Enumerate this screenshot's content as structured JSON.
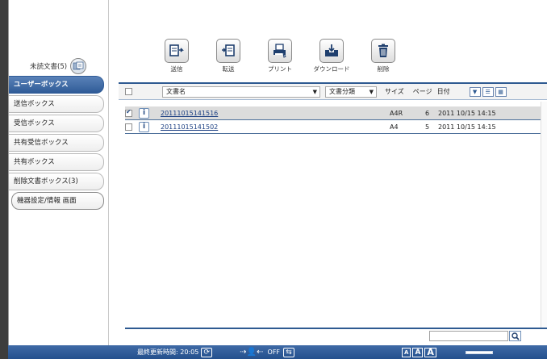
{
  "sidebar": {
    "unread_label": "未読文書(5)",
    "items": [
      {
        "label": "ユーザーボックス",
        "active": true
      },
      {
        "label": "送信ボックス"
      },
      {
        "label": "受信ボックス"
      },
      {
        "label": "共有受信ボックス"
      },
      {
        "label": "共有ボックス"
      },
      {
        "label": "削除文書ボックス(3)"
      }
    ],
    "settings_label": "機器設定/情報 画面"
  },
  "toolbar": {
    "send": "送信",
    "transfer": "転送",
    "print": "プリント",
    "download": "ダウンロード",
    "delete": "削除"
  },
  "table": {
    "col_docname": "文書名",
    "col_category": "文書分類",
    "col_size": "サイズ",
    "col_pages": "ページ",
    "col_date": "日付",
    "rows": [
      {
        "checked": true,
        "name": "20111015141516",
        "size": "A4R",
        "pages": "6",
        "date": "2011 10/15 14:15"
      },
      {
        "checked": false,
        "name": "20111015141502",
        "size": "A4",
        "pages": "5",
        "date": "2011 10/15 14:15"
      }
    ]
  },
  "status": {
    "last_update": "最終更新時間: 20:05",
    "lock": "OFF",
    "font_small": "A",
    "font_medium": "A",
    "font_large": "A"
  },
  "colors": {
    "accent": "#2e5a91",
    "selected_row": "#dcdcdc"
  }
}
